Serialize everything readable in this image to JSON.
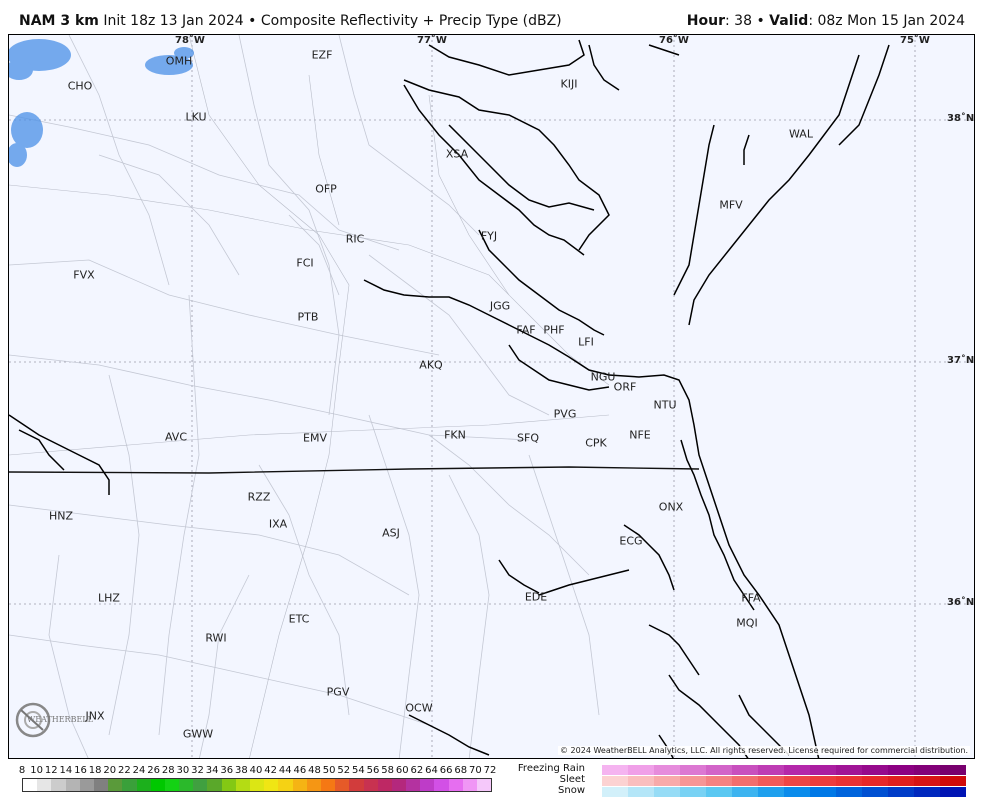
{
  "header": {
    "model": "NAM 3 km",
    "init": "Init 18z 13 Jan 2024",
    "bullet": "•",
    "product": "Composite Reflectivity + Precip Type (dBZ)",
    "hour_label": "Hour",
    "hour_value": ": 38",
    "valid_label": "Valid",
    "valid_value": ": 08z Mon 15 Jan 2024"
  },
  "map": {
    "lon_labels": [
      "78˚W",
      "77˚W",
      "76˚W",
      "75˚W"
    ],
    "lat_labels": [
      "38˚N",
      "37˚N",
      "36˚N"
    ],
    "stations": [
      "EZF",
      "OMH",
      "CHO",
      "KIJI",
      "LKU",
      "XSA",
      "WAL",
      "OFP",
      "MFV",
      "RIC",
      "FYJ",
      "FCI",
      "FVX",
      "JGG",
      "PTB",
      "FAF",
      "PHF",
      "LFI",
      "AKQ",
      "NGU",
      "ORF",
      "PVG",
      "NTU",
      "AVC",
      "EMV",
      "FKN",
      "SFQ",
      "CPK",
      "NFE",
      "RZZ",
      "ONX",
      "HNZ",
      "IXA",
      "ASJ",
      "ECG",
      "LHZ",
      "EDE",
      "FFA",
      "MQI",
      "RWI",
      "ETC",
      "PGV",
      "JNX",
      "OCW",
      "GWW"
    ],
    "copyright": "© 2024 WeatherBELL Analytics, LLC. All rights reserved. License required for commercial distribution.",
    "logo_text": "WEATHERBELL"
  },
  "legend": {
    "dbz_ticks": [
      "8",
      "10",
      "12",
      "14",
      "16",
      "18",
      "20",
      "22",
      "24",
      "26",
      "28",
      "30",
      "32",
      "34",
      "36",
      "38",
      "40",
      "42",
      "44",
      "46",
      "48",
      "50",
      "52",
      "54",
      "56",
      "58",
      "60",
      "62",
      "64",
      "66",
      "68",
      "70",
      "72"
    ],
    "dbz_colors": [
      "#ffffff",
      "#e6e6e6",
      "#cccccc",
      "#b4b4b4",
      "#9a9a9a",
      "#808080",
      "#5a9a3a",
      "#3aa03a",
      "#1cb01c",
      "#00c800",
      "#14d214",
      "#2bb92b",
      "#40a040",
      "#5aa82a",
      "#84c814",
      "#b4dc14",
      "#dce614",
      "#f0e614",
      "#f5d214",
      "#f5b414",
      "#f59614",
      "#f57814",
      "#e65a28",
      "#d23c3c",
      "#c83250",
      "#be2864",
      "#b4287d",
      "#b432a0",
      "#be3cc8",
      "#d250e6",
      "#e66ef0",
      "#f096f5",
      "#f5c8fa"
    ],
    "precip_types": [
      "Freezing Rain",
      "Sleet",
      "Snow"
    ],
    "freezing_rain_colors": [
      "#f5b4f0",
      "#f0a0e8",
      "#e68cdc",
      "#dc78d2",
      "#d264c8",
      "#c850be",
      "#be3cb4",
      "#b428aa",
      "#aa1ea0",
      "#a01496",
      "#960a8c",
      "#8c0082",
      "#820078",
      "#78006e"
    ],
    "sleet_colors": [
      "#fcd2d2",
      "#fabebe",
      "#f8aaaa",
      "#f69696",
      "#f48282",
      "#f26e6e",
      "#f05a5a",
      "#ee4646",
      "#ec3c3c",
      "#ea3232",
      "#e82828",
      "#e01e1e",
      "#d81414",
      "#d00a0a"
    ],
    "snow_colors": [
      "#d2f0fa",
      "#b4e6f8",
      "#96dcf6",
      "#78d2f4",
      "#5ac8f2",
      "#3cb4f0",
      "#1ea0ee",
      "#0a8cec",
      "#0078e6",
      "#0064dc",
      "#0050d2",
      "#003cc8",
      "#0028be",
      "#0014b4"
    ],
    "radar_echo_color": "#4a90e8"
  }
}
